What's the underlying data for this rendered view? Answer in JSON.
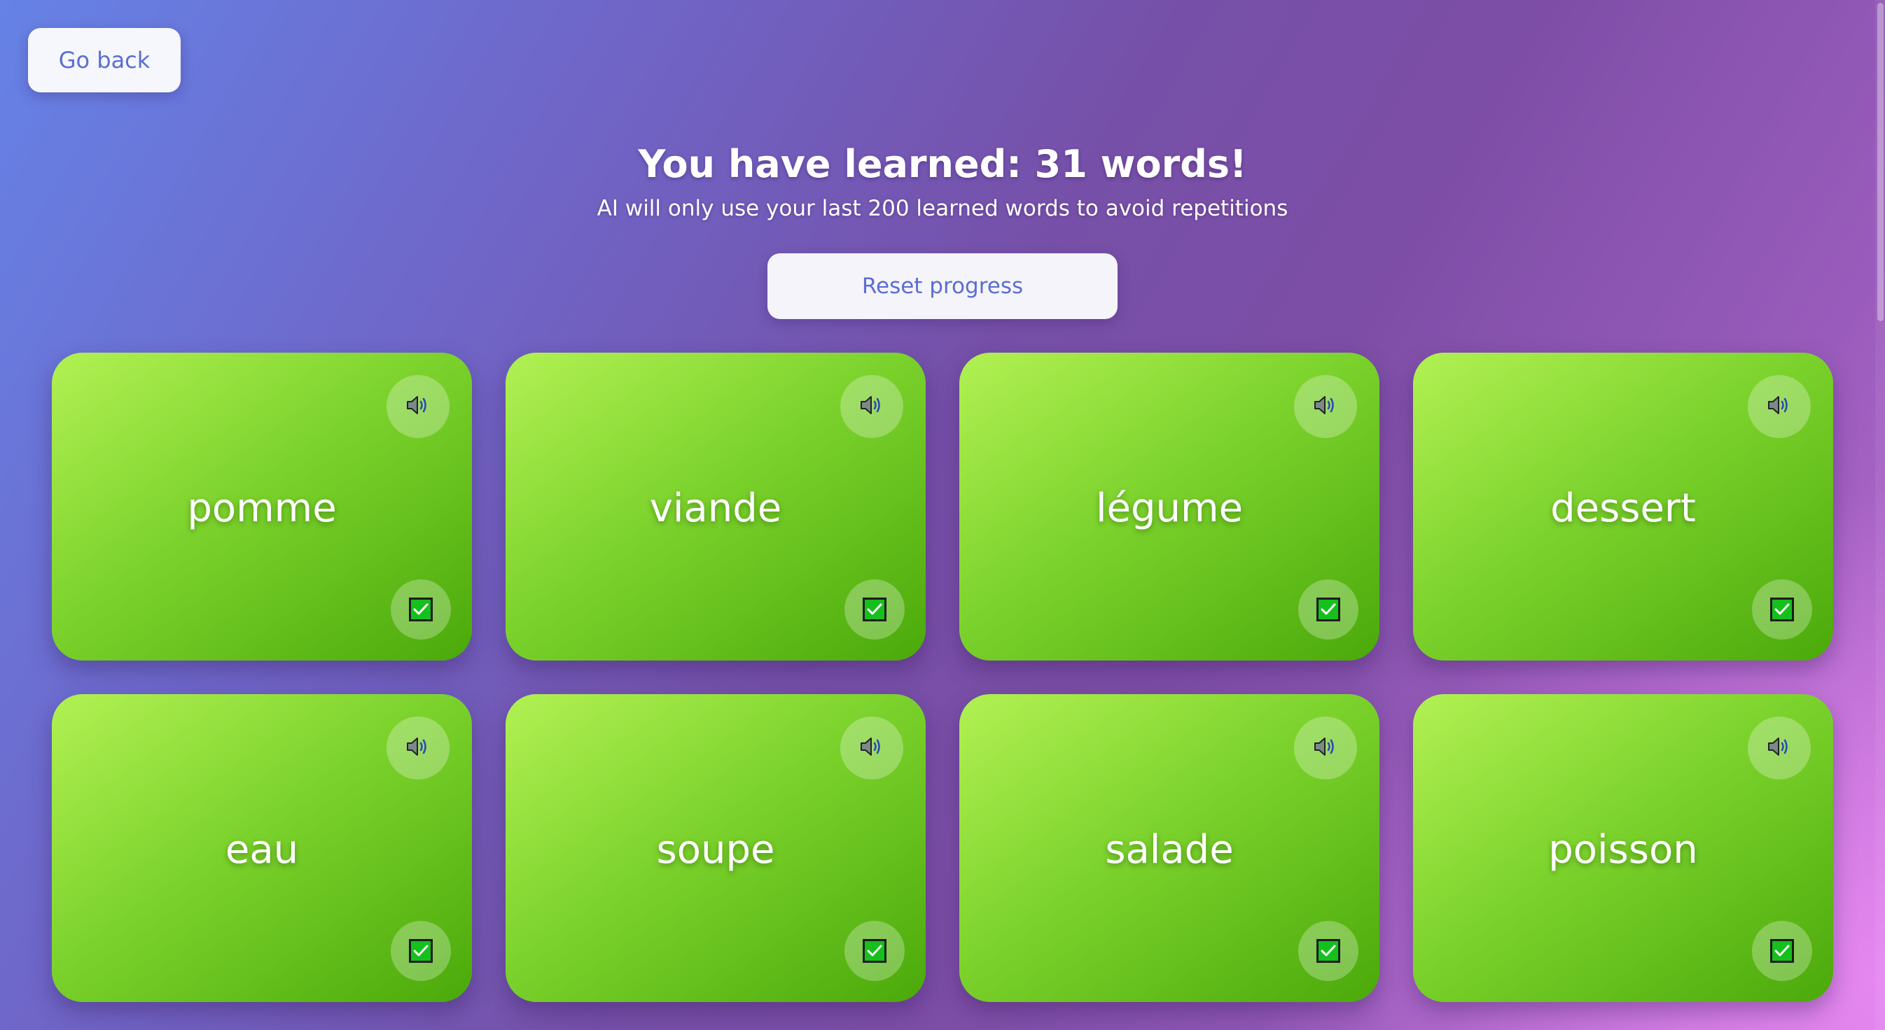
{
  "nav": {
    "go_back_label": "Go back"
  },
  "header": {
    "title": "You have learned: 31 words!",
    "subtitle": "AI will only use your last 200 learned words to avoid repetitions"
  },
  "actions": {
    "reset_label": "Reset progress"
  },
  "icons": {
    "speak": "speaker-icon",
    "learned": "checkbox-checked-icon"
  },
  "colors": {
    "card_gradient_start": "#b2f153",
    "card_gradient_end": "#4aa90a",
    "button_text": "#5a6ed1",
    "check_fill": "#16c01c"
  },
  "words": [
    {
      "word": "pomme",
      "learned": true
    },
    {
      "word": "viande",
      "learned": true
    },
    {
      "word": "légume",
      "learned": true
    },
    {
      "word": "dessert",
      "learned": true
    },
    {
      "word": "eau",
      "learned": true
    },
    {
      "word": "soupe",
      "learned": true
    },
    {
      "word": "salade",
      "learned": true
    },
    {
      "word": "poisson",
      "learned": true
    }
  ]
}
